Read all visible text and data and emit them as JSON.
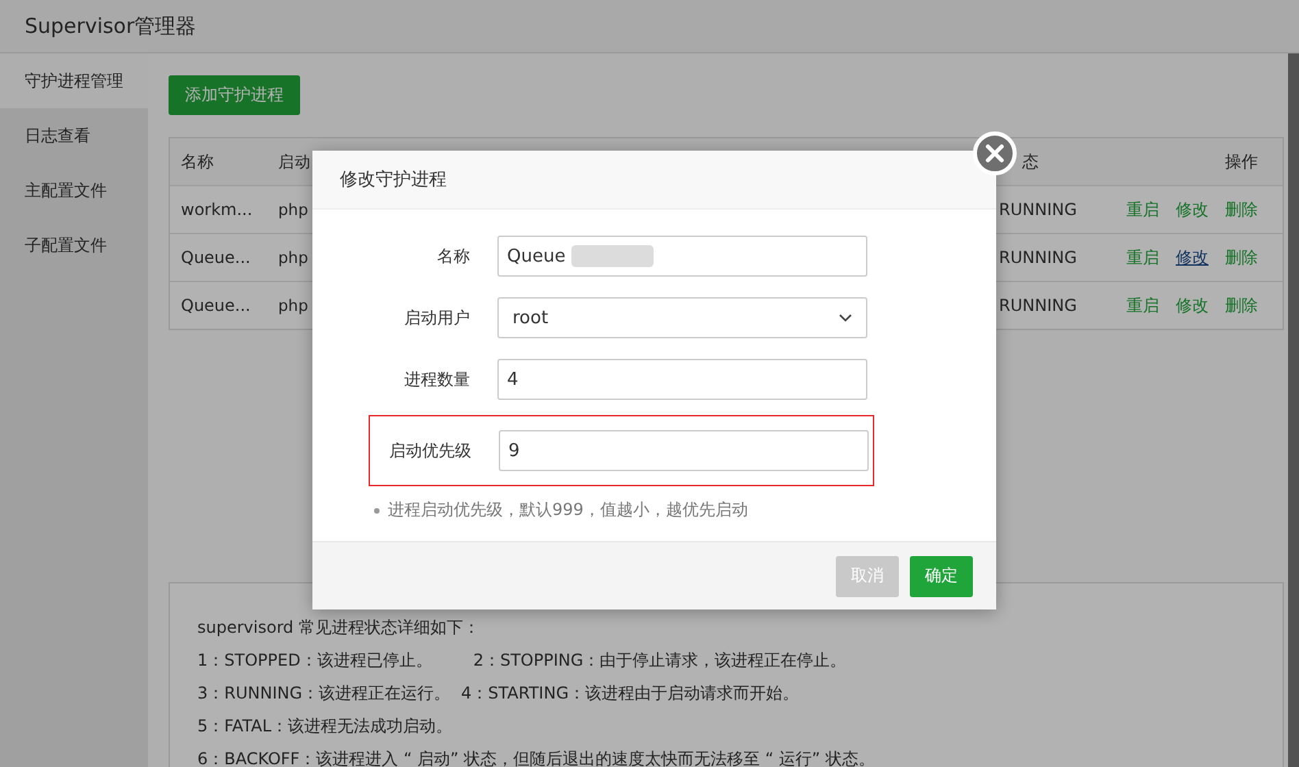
{
  "window": {
    "title": "Supervisor管理器"
  },
  "sidebar": {
    "items": [
      {
        "label": "守护进程管理",
        "selected": true
      },
      {
        "label": "日志查看",
        "selected": false
      },
      {
        "label": "主配置文件",
        "selected": false
      },
      {
        "label": "子配置文件",
        "selected": false
      }
    ]
  },
  "add_button": "添加守护进程",
  "table": {
    "columns": [
      "名称",
      "启动",
      "态",
      "操作"
    ],
    "rows": [
      {
        "cells": [
          "workm...",
          "php",
          "RUNNING"
        ],
        "actions": [
          {
            "label": "重启",
            "hovered": false
          },
          {
            "label": "修改",
            "hovered": false
          },
          {
            "label": "删除",
            "hovered": false
          }
        ]
      },
      {
        "cells": [
          "Queue...",
          "php",
          "RUNNING"
        ],
        "actions": [
          {
            "label": "重启",
            "hovered": false
          },
          {
            "label": "修改",
            "hovered": true
          },
          {
            "label": "删除",
            "hovered": false
          }
        ]
      },
      {
        "cells": [
          "Queue...",
          "php",
          "RUNNING"
        ],
        "actions": [
          {
            "label": "重启",
            "hovered": false
          },
          {
            "label": "修改",
            "hovered": false
          },
          {
            "label": "删除",
            "hovered": false
          }
        ]
      }
    ]
  },
  "info": {
    "lines": [
      [
        "supervisord 常见进程状态详细如下："
      ],
      [
        "1：STOPPED：该进程已停止。",
        "2：STOPPING：由于停止请求，该进程正在停止。"
      ],
      [
        "3：RUNNING：该进程正在运行。",
        "4：STARTING：该进程由于启动请求而开始。"
      ],
      [
        "5：FATAL：该进程无法成功启动。"
      ],
      [
        "6：BACKOFF：该进程进入 “ 启动” 状态，但随后退出的速度太快而无法移至 “ 运行” 状态。"
      ]
    ]
  },
  "dialog": {
    "title": "修改守护进程",
    "fields": [
      {
        "kind": "text",
        "label": "名称",
        "value": "Queue",
        "redacted": true,
        "highlighted": false
      },
      {
        "kind": "select",
        "label": "启动用户",
        "value": "root",
        "highlighted": false
      },
      {
        "kind": "text",
        "label": "进程数量",
        "value": "4",
        "highlighted": false
      },
      {
        "kind": "text",
        "label": "启动优先级",
        "value": "9",
        "highlighted": true
      }
    ],
    "hint": "进程启动优先级，默认999，值越小，越优先启动",
    "buttons": [
      {
        "kind": "secondary",
        "label": "取消"
      },
      {
        "kind": "primary",
        "label": "确定"
      }
    ]
  }
}
